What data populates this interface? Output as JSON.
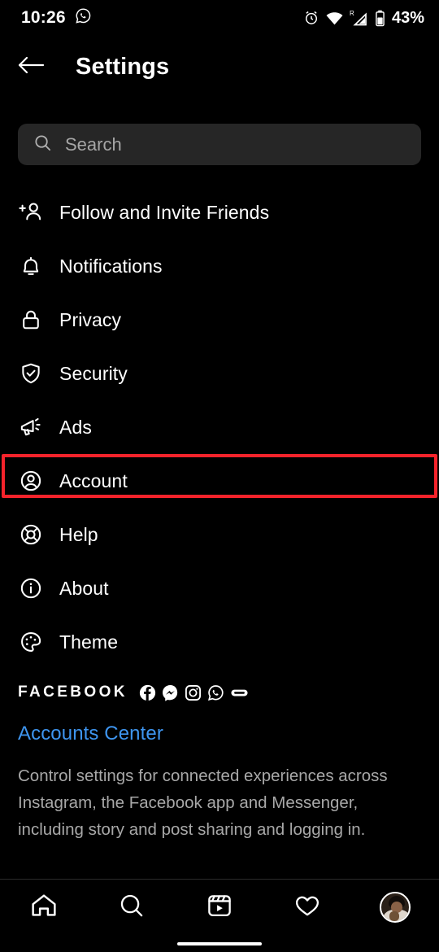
{
  "status_bar": {
    "time": "10:26",
    "left_icons": [
      "whatsapp-icon"
    ],
    "right_icons": [
      "alarm-icon",
      "wifi-icon",
      "signal-roaming-icon",
      "battery-icon"
    ],
    "roaming_label": "R",
    "battery_percent": "43%"
  },
  "header": {
    "back_icon": "back-arrow-icon",
    "title": "Settings"
  },
  "search": {
    "icon": "search-icon",
    "placeholder": "Search",
    "value": ""
  },
  "menu": {
    "items": [
      {
        "label": "Follow and Invite Friends",
        "icon": "add-person-icon"
      },
      {
        "label": "Notifications",
        "icon": "bell-icon"
      },
      {
        "label": "Privacy",
        "icon": "lock-icon"
      },
      {
        "label": "Security",
        "icon": "shield-check-icon"
      },
      {
        "label": "Ads",
        "icon": "megaphone-icon"
      },
      {
        "label": "Account",
        "icon": "account-circle-icon"
      },
      {
        "label": "Help",
        "icon": "lifebuoy-icon"
      },
      {
        "label": "About",
        "icon": "info-circle-icon"
      },
      {
        "label": "Theme",
        "icon": "palette-icon"
      }
    ],
    "highlighted_item": "Account",
    "highlight_color": "#f5232b"
  },
  "facebook_section": {
    "heading": "FACEBOOK",
    "brand_icons": [
      "facebook-icon",
      "messenger-icon",
      "instagram-icon",
      "whatsapp-icon",
      "meta-oval-icon"
    ],
    "link_label": "Accounts Center",
    "link_color": "#3e95ef",
    "description": "Control settings for connected experiences across Instagram, the Facebook app and Messenger, including story and post sharing and logging in."
  },
  "bottom_nav": {
    "items": [
      {
        "name": "home-icon",
        "label": "Home"
      },
      {
        "name": "search-icon",
        "label": "Search"
      },
      {
        "name": "reels-icon",
        "label": "Reels"
      },
      {
        "name": "heart-icon",
        "label": "Activity"
      },
      {
        "name": "profile-avatar",
        "label": "Profile"
      }
    ]
  },
  "colors": {
    "background": "#000000",
    "search_field": "#262626",
    "text_primary": "#ffffff",
    "text_secondary": "#a8a8a8",
    "link": "#3e95ef",
    "highlight": "#f5232b"
  }
}
